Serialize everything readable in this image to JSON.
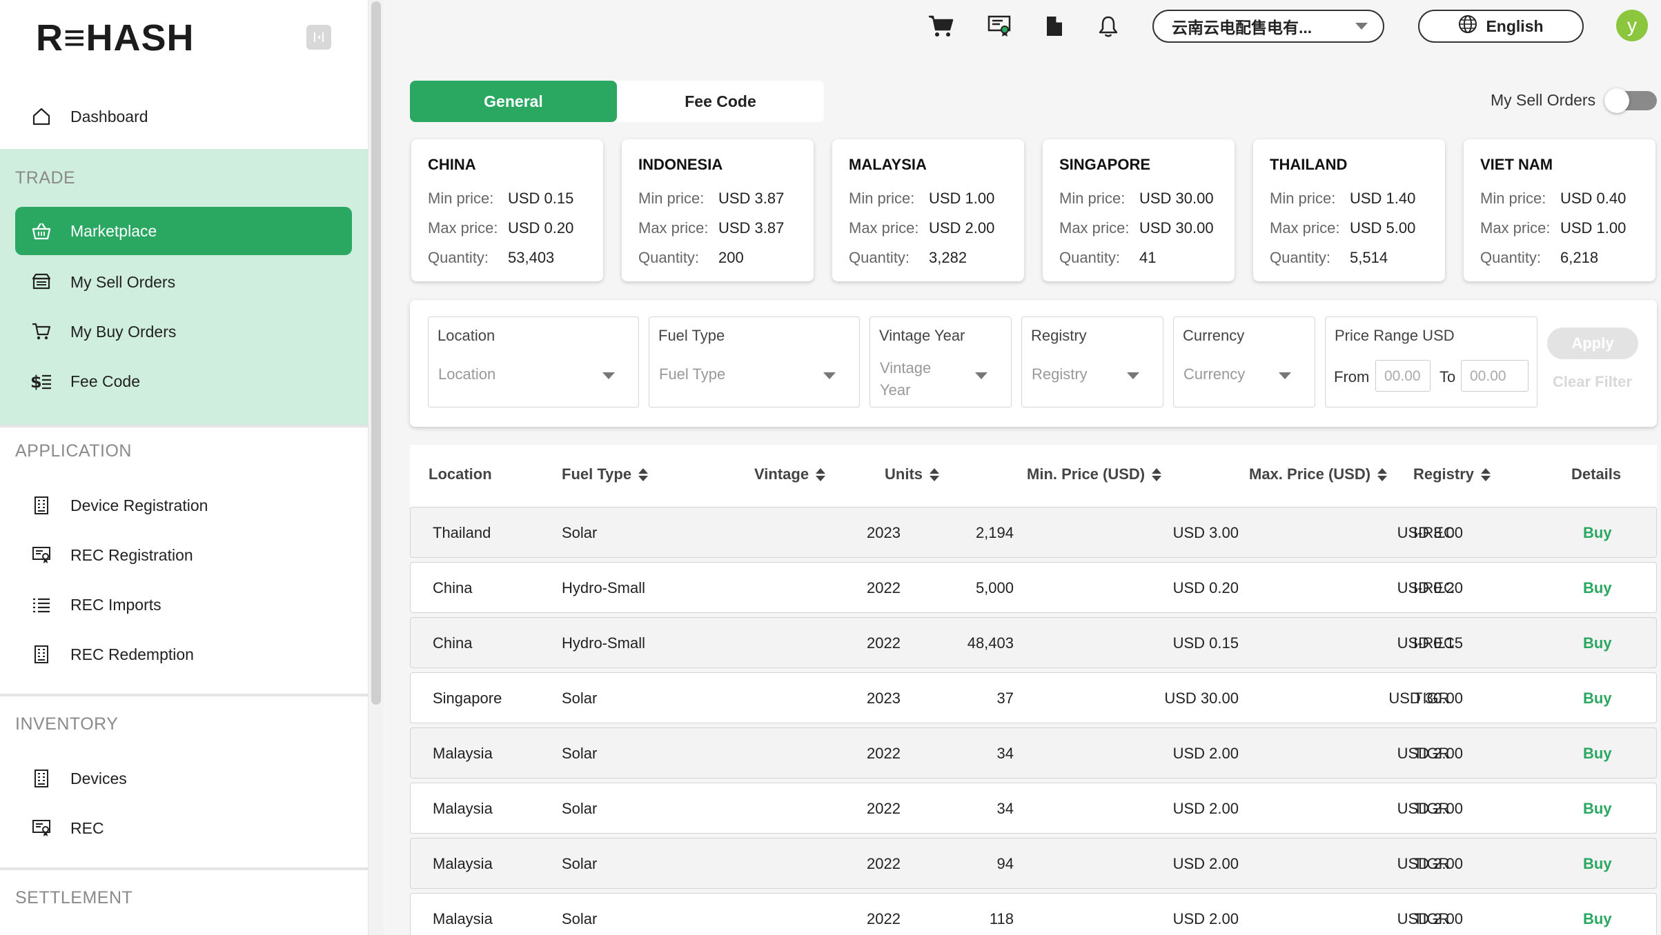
{
  "brand": {
    "logo": "R≡HASH"
  },
  "sidebar": {
    "dashboard": "Dashboard",
    "trade_label": "TRADE",
    "trade_items": [
      {
        "label": "Marketplace"
      },
      {
        "label": "My Sell Orders"
      },
      {
        "label": "My Buy Orders"
      },
      {
        "label": "Fee Code"
      }
    ],
    "application_label": "APPLICATION",
    "application_items": [
      {
        "label": "Device Registration"
      },
      {
        "label": "REC Registration"
      },
      {
        "label": "REC Imports"
      },
      {
        "label": "REC Redemption"
      }
    ],
    "inventory_label": "INVENTORY",
    "inventory_items": [
      {
        "label": "Devices"
      },
      {
        "label": "REC"
      }
    ],
    "settlement_label": "SETTLEMENT"
  },
  "header": {
    "company": "云南云电配售电有...",
    "language": "English",
    "avatar_initial": "y",
    "icons": [
      "cart-icon",
      "certificate-icon",
      "document-icon",
      "bell-icon"
    ]
  },
  "tabs": {
    "general": "General",
    "fee_code": "Fee Code"
  },
  "my_sell_orders_toggle": {
    "label": "My Sell Orders",
    "on": false
  },
  "summary_labels": {
    "min": "Min price:",
    "max": "Max price:",
    "qty": "Quantity:"
  },
  "countries": [
    {
      "name": "CHINA",
      "min": "USD 0.15",
      "max": "USD 0.20",
      "qty": "53,403"
    },
    {
      "name": "INDONESIA",
      "min": "USD 3.87",
      "max": "USD 3.87",
      "qty": "200"
    },
    {
      "name": "MALAYSIA",
      "min": "USD 1.00",
      "max": "USD 2.00",
      "qty": "3,282"
    },
    {
      "name": "SINGAPORE",
      "min": "USD 30.00",
      "max": "USD 30.00",
      "qty": "41"
    },
    {
      "name": "THAILAND",
      "min": "USD 1.40",
      "max": "USD 5.00",
      "qty": "5,514"
    },
    {
      "name": "VIET NAM",
      "min": "USD 0.40",
      "max": "USD 1.00",
      "qty": "6,218"
    }
  ],
  "filters": {
    "location": {
      "label": "Location",
      "placeholder": "Location"
    },
    "fuel_type": {
      "label": "Fuel Type",
      "placeholder": "Fuel Type"
    },
    "vintage_year": {
      "label": "Vintage Year",
      "placeholder": "Vintage Year"
    },
    "registry": {
      "label": "Registry",
      "placeholder": "Registry"
    },
    "currency": {
      "label": "Currency",
      "placeholder": "Currency"
    },
    "price_range": {
      "label": "Price Range USD",
      "from_label": "From",
      "to_label": "To",
      "from_placeholder": "00.00",
      "to_placeholder": "00.00"
    },
    "apply": "Apply",
    "clear": "Clear Filter"
  },
  "table": {
    "columns": {
      "location": "Location",
      "fuel_type": "Fuel Type",
      "vintage": "Vintage",
      "units": "Units",
      "min_price": "Min. Price (USD)",
      "max_price": "Max. Price (USD)",
      "registry": "Registry",
      "details": "Details"
    },
    "rows": [
      {
        "location": "Thailand",
        "fuel": "Solar",
        "vintage": "2023",
        "units": "2,194",
        "min": "USD 3.00",
        "max": "USD 3.00",
        "registry": "I-REC",
        "action": "Buy"
      },
      {
        "location": "China",
        "fuel": "Hydro-Small",
        "vintage": "2022",
        "units": "5,000",
        "min": "USD 0.20",
        "max": "USD 0.20",
        "registry": "I-REC",
        "action": "Buy"
      },
      {
        "location": "China",
        "fuel": "Hydro-Small",
        "vintage": "2022",
        "units": "48,403",
        "min": "USD 0.15",
        "max": "USD 0.15",
        "registry": "I-REC",
        "action": "Buy"
      },
      {
        "location": "Singapore",
        "fuel": "Solar",
        "vintage": "2023",
        "units": "37",
        "min": "USD 30.00",
        "max": "USD 30.00",
        "registry": "TIGR",
        "action": "Buy"
      },
      {
        "location": "Malaysia",
        "fuel": "Solar",
        "vintage": "2022",
        "units": "34",
        "min": "USD 2.00",
        "max": "USD 2.00",
        "registry": "TIGR",
        "action": "Buy"
      },
      {
        "location": "Malaysia",
        "fuel": "Solar",
        "vintage": "2022",
        "units": "34",
        "min": "USD 2.00",
        "max": "USD 2.00",
        "registry": "TIGR",
        "action": "Buy"
      },
      {
        "location": "Malaysia",
        "fuel": "Solar",
        "vintage": "2022",
        "units": "94",
        "min": "USD 2.00",
        "max": "USD 2.00",
        "registry": "TIGR",
        "action": "Buy"
      },
      {
        "location": "Malaysia",
        "fuel": "Solar",
        "vintage": "2022",
        "units": "118",
        "min": "USD 2.00",
        "max": "USD 2.00",
        "registry": "TIGR",
        "action": "Buy"
      }
    ]
  },
  "colors": {
    "accent": "#2aa862",
    "trade_bg": "#cfeedd",
    "page_bg": "#f5f5f5"
  }
}
